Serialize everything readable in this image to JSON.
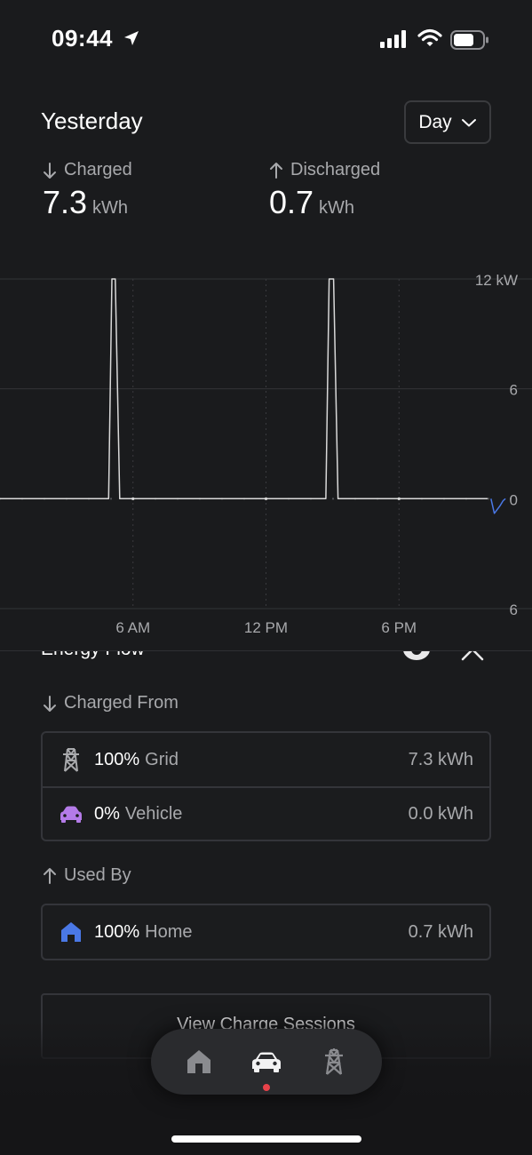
{
  "status_bar": {
    "time": "09:44",
    "icons": [
      "location-arrow-icon",
      "signal-icon",
      "wifi-icon",
      "battery-icon"
    ]
  },
  "header": {
    "title": "Yesterday",
    "period_select": {
      "value": "Day",
      "icon": "chevron-down-icon"
    }
  },
  "summary": {
    "charged": {
      "label": "Charged",
      "value": "7.3",
      "unit": "kWh",
      "icon": "arrow-down-icon"
    },
    "discharged": {
      "label": "Discharged",
      "value": "0.7",
      "unit": "kWh",
      "icon": "arrow-up-icon"
    }
  },
  "chart_data": {
    "type": "line",
    "y_tick_labels": [
      "12 kW",
      "6",
      "0",
      "6"
    ],
    "y_values": [
      12,
      6,
      0,
      -6
    ],
    "x_tick_labels": [
      "6 AM",
      "12 PM",
      "6 PM"
    ],
    "series": [
      {
        "color": "#d9d9d9",
        "points": [
          [
            0,
            0
          ],
          [
            4.9,
            0
          ],
          [
            5.05,
            12
          ],
          [
            5.2,
            12
          ],
          [
            5.4,
            0
          ],
          [
            14.7,
            0
          ],
          [
            14.85,
            12
          ],
          [
            15.05,
            12
          ],
          [
            15.25,
            0
          ],
          [
            22,
            0
          ]
        ]
      },
      {
        "color": "#4a78e6",
        "points": [
          [
            22.15,
            0
          ],
          [
            22.3,
            -0.8
          ],
          [
            22.55,
            -0.4
          ],
          [
            22.7,
            -0.1
          ],
          [
            22.8,
            0
          ]
        ]
      }
    ],
    "ylim": [
      -6,
      12
    ],
    "xlim": [
      0,
      24
    ],
    "grid": true
  },
  "energy_flow": {
    "title": "Energy Flow",
    "icons": [
      "eye-icon",
      "close-icon"
    ],
    "charged_from": {
      "label": "Charged From",
      "rows": [
        {
          "icon": "grid-tower-icon",
          "percent": "100%",
          "name": "Grid",
          "value": "7.3 kWh",
          "color": "#a8a9ac"
        },
        {
          "icon": "vehicle-icon",
          "percent": "0%",
          "name": "Vehicle",
          "value": "0.0 kWh",
          "color": "#b47be8"
        }
      ]
    },
    "used_by": {
      "label": "Used By",
      "rows": [
        {
          "icon": "home-icon",
          "percent": "100%",
          "name": "Home",
          "value": "0.7 kWh",
          "color": "#4a78e6"
        }
      ]
    }
  },
  "sessions_button": {
    "label": "View Charge Sessions"
  },
  "tabbar": {
    "tabs": [
      "home-icon",
      "car-icon",
      "grid-tower-icon"
    ],
    "active": "car-icon",
    "indicator_color": "#e8424a"
  }
}
